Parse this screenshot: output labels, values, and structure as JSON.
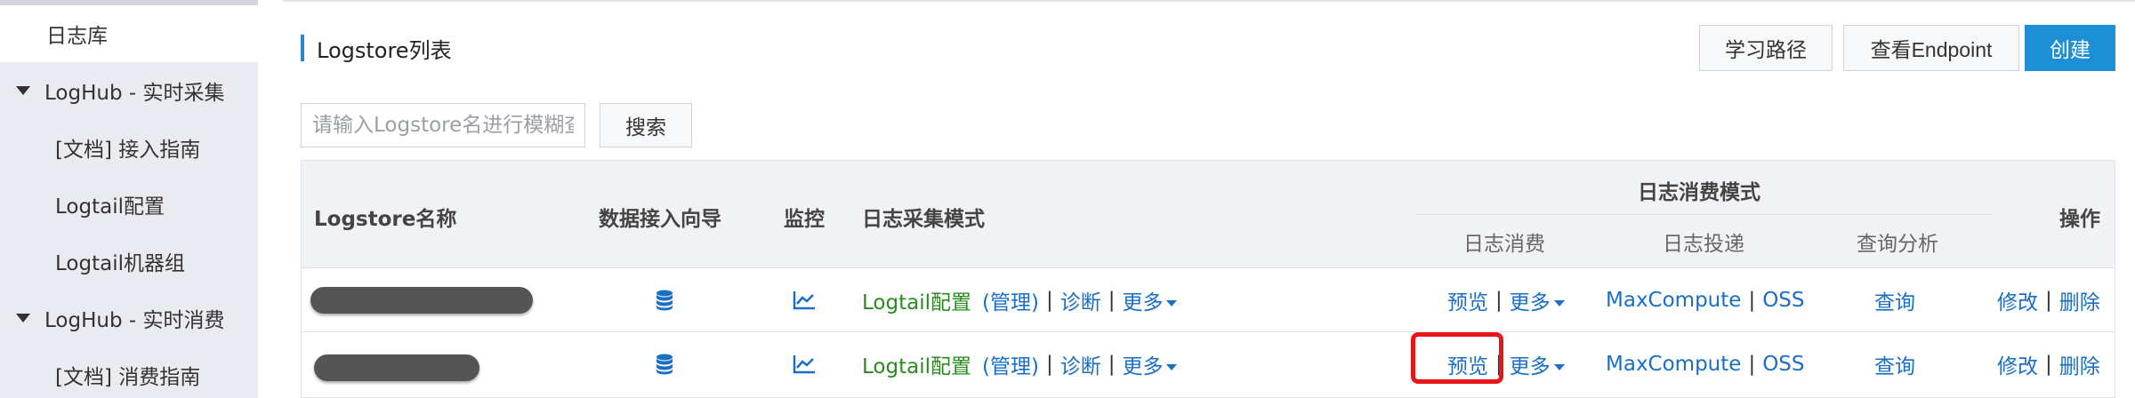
{
  "sidebar": {
    "items": [
      {
        "label": "日志库",
        "active": true
      },
      {
        "label": "LogHub - 实时采集",
        "expandable": true
      },
      {
        "label": "[文档] 接入指南"
      },
      {
        "label": "Logtail配置"
      },
      {
        "label": "Logtail机器组"
      },
      {
        "label": "LogHub - 实时消费",
        "expandable": true
      },
      {
        "label": "[文档] 消费指南"
      }
    ]
  },
  "header": {
    "title": "Logstore列表",
    "buttons": {
      "learning_path": "学习路径",
      "view_endpoint": "查看Endpoint",
      "create": "创建"
    }
  },
  "search": {
    "placeholder": "请输入Logstore名进行模糊查询",
    "button": "搜索"
  },
  "table": {
    "headers": {
      "name": "Logstore名称",
      "wizard": "数据接入向导",
      "monitor": "监控",
      "collect_mode": "日志采集模式",
      "consume_group": "日志消费模式",
      "consume": "日志消费",
      "ship": "日志投递",
      "query": "查询分析",
      "actions": "操作"
    },
    "rows": [
      {
        "logtail": "Logtail配置",
        "manage": "(管理)",
        "diagnose": "诊断",
        "more": "更多",
        "preview": "预览",
        "consume_more": "更多",
        "maxcompute": "MaxCompute",
        "oss": "OSS",
        "query": "查询",
        "edit": "修改",
        "delete": "删除"
      },
      {
        "logtail": "Logtail配置",
        "manage": "(管理)",
        "diagnose": "诊断",
        "more": "更多",
        "preview": "预览",
        "consume_more": "更多",
        "maxcompute": "MaxCompute",
        "oss": "OSS",
        "query": "查询",
        "edit": "修改",
        "delete": "删除"
      }
    ]
  },
  "colors": {
    "accent": "#1d8fd6",
    "link": "#1a6fc4",
    "logtail_green": "#2a8a1f",
    "highlight": "#e8151b"
  },
  "icons": {
    "wizard": "database-icon",
    "monitor": "line-chart-icon",
    "dropdown": "caret-down-icon",
    "expand": "triangle-down-icon"
  }
}
